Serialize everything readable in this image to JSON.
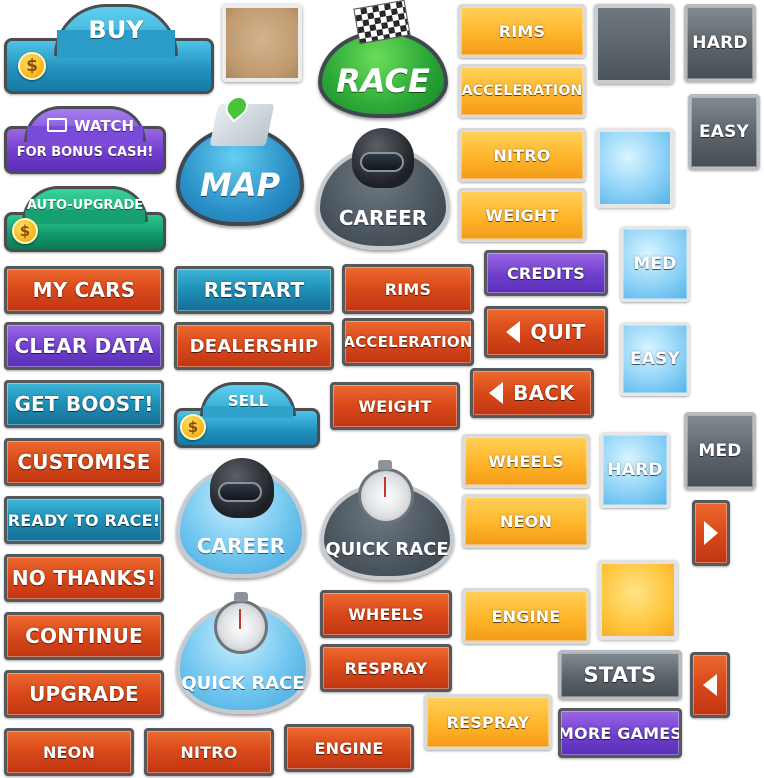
{
  "buy_tab": {
    "label": "BUY",
    "coin": "$"
  },
  "watch_tab": {
    "line1": "WATCH",
    "line2": "FOR BONUS CASH!",
    "icon": "film-camera-icon"
  },
  "auto_upgrade_tab": {
    "label": "AUTO-UPGRADE",
    "coin": "$"
  },
  "sell_tab": {
    "label": "SELL",
    "coin": "$"
  },
  "domes": {
    "race": "RACE",
    "map": "MAP",
    "career_dark": "CAREER",
    "career_blue": "CAREER",
    "quick_race_dark": "QUICK RACE",
    "quick_race_blue": "QUICK RACE"
  },
  "menu_buttons": {
    "my_cars": "MY CARS",
    "clear_data": "CLEAR DATA",
    "get_boost": "GET BOOST!",
    "customise": "CUSTOMISE",
    "ready_to_race": "READY TO RACE!",
    "no_thanks": "NO THANKS!",
    "continue": "CONTINUE",
    "upgrade": "UPGRADE",
    "restart": "RESTART",
    "dealership": "DEALERSHIP",
    "credits": "CREDITS",
    "quit": "QUIT",
    "back": "BACK",
    "stats": "STATS",
    "more_games": "MORE GAMES"
  },
  "red_parts": {
    "rims": "RIMS",
    "acceleration": "ACCELERATION",
    "weight": "WEIGHT",
    "wheels": "WHEELS",
    "respray": "RESPRAY",
    "neon": "NEON",
    "nitro": "NITRO",
    "engine": "ENGINE"
  },
  "orange_parts": {
    "rims": "RIMS",
    "acceleration": "ACCELERATION",
    "nitro": "NITRO",
    "weight": "WEIGHT",
    "wheels": "WHEELS",
    "neon": "NEON",
    "engine": "ENGINE",
    "respray": "RESPRAY"
  },
  "difficulty": {
    "hard_dark_top": "HARD",
    "easy_dark": "EASY",
    "med_ice": "MED",
    "easy_ice": "EASY",
    "hard_ice": "HARD",
    "med_dark": "MED"
  }
}
